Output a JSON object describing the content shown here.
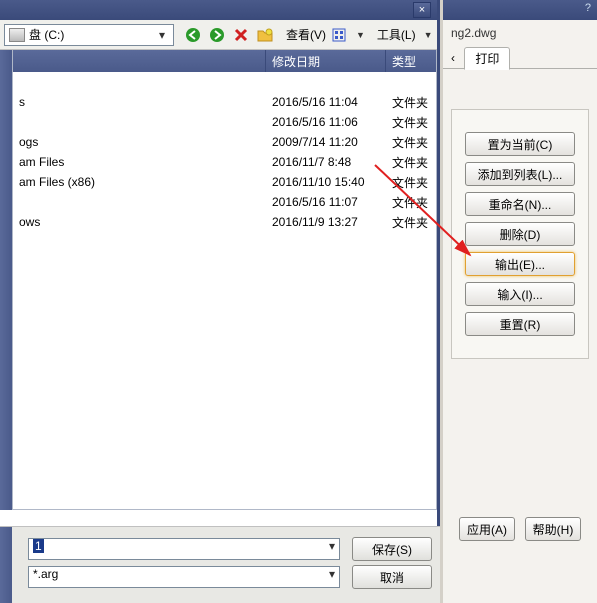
{
  "toolbar": {
    "path_label": "盘 (C:)",
    "view_label": "查看(V)",
    "tools_label": "工具(L)"
  },
  "columns": {
    "name": "",
    "date": "修改日期",
    "type": "类型"
  },
  "files": [
    {
      "name": "",
      "date": "",
      "type": ""
    },
    {
      "name": "s",
      "date": "2016/5/16 11:04",
      "type": "文件夹"
    },
    {
      "name": "",
      "date": "2016/5/16 11:06",
      "type": "文件夹"
    },
    {
      "name": "ogs",
      "date": "2009/7/14 11:20",
      "type": "文件夹"
    },
    {
      "name": "am Files",
      "date": "2016/11/7 8:48",
      "type": "文件夹"
    },
    {
      "name": "am Files (x86)",
      "date": "2016/11/10 15:40",
      "type": "文件夹"
    },
    {
      "name": "",
      "date": "2016/5/16 11:07",
      "type": "文件夹"
    },
    {
      "name": "ows",
      "date": "2016/11/9 13:27",
      "type": "文件夹"
    }
  ],
  "filename_field": "1",
  "filetype_field": "*.arg",
  "save_btn": "保存(S)",
  "cancel_btn": "取消",
  "right": {
    "tab_file": "ng2.dwg",
    "tab_print": "打印",
    "buttons": {
      "set_current": "置为当前(C)",
      "add_to_list": "添加到列表(L)...",
      "rename": "重命名(N)...",
      "delete": "删除(D)",
      "export": "输出(E)...",
      "import": "输入(I)...",
      "reset": "重置(R)"
    },
    "apply": "应用(A)",
    "help": "帮助(H)"
  }
}
